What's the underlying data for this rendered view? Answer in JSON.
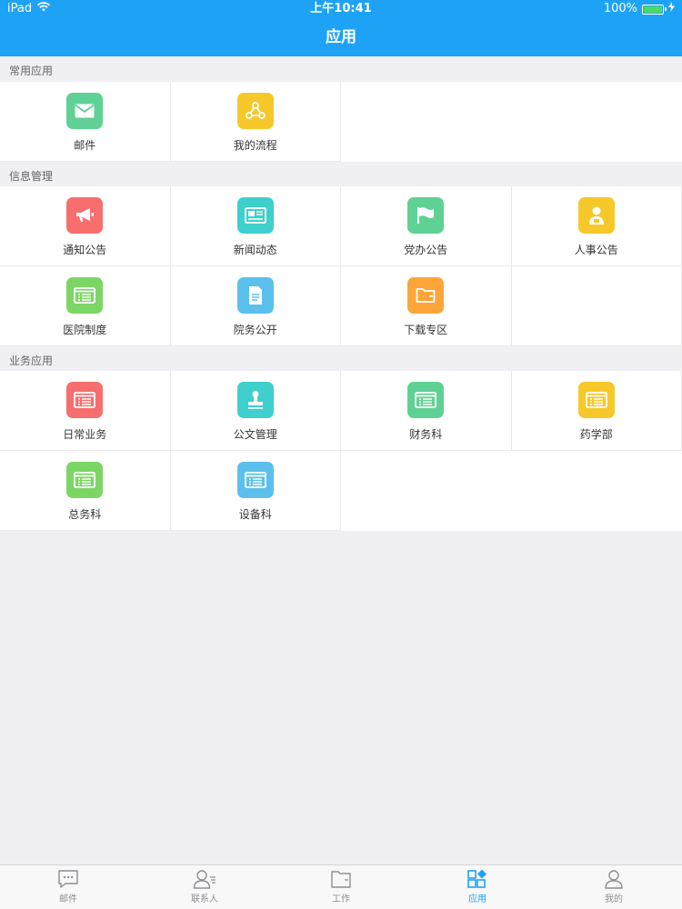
{
  "status_bar": {
    "device": "iPad",
    "time": "上午10:41",
    "battery": "100%"
  },
  "header": {
    "title": "应用"
  },
  "sections": [
    {
      "title": "常用应用",
      "items": [
        {
          "label": "邮件",
          "icon": "mail-icon",
          "color": "#5fd195"
        },
        {
          "label": "我的流程",
          "icon": "workflow-icon",
          "color": "#f7c82a"
        }
      ]
    },
    {
      "title": "信息管理",
      "items": [
        {
          "label": "通知公告",
          "icon": "megaphone-icon",
          "color": "#f76e6e"
        },
        {
          "label": "新闻动态",
          "icon": "newspaper-icon",
          "color": "#3fcfcc"
        },
        {
          "label": "党办公告",
          "icon": "flag-icon",
          "color": "#5fd195"
        },
        {
          "label": "人事公告",
          "icon": "person-icon",
          "color": "#f7c82a"
        },
        {
          "label": "医院制度",
          "icon": "list-icon",
          "color": "#7bd665"
        },
        {
          "label": "院务公开",
          "icon": "document-icon",
          "color": "#5bc0eb"
        },
        {
          "label": "下载专区",
          "icon": "folder-icon",
          "color": "#fca53a"
        }
      ]
    },
    {
      "title": "业务应用",
      "items": [
        {
          "label": "日常业务",
          "icon": "list-icon",
          "color": "#f76e6e"
        },
        {
          "label": "公文管理",
          "icon": "stamp-icon",
          "color": "#3fcfcc"
        },
        {
          "label": "财务科",
          "icon": "list-icon",
          "color": "#5fd195"
        },
        {
          "label": "药学部",
          "icon": "list-icon",
          "color": "#f7c82a"
        },
        {
          "label": "总务科",
          "icon": "list-icon",
          "color": "#7bd665"
        },
        {
          "label": "设备科",
          "icon": "list-icon",
          "color": "#5bc0eb"
        }
      ]
    }
  ],
  "tabbar": {
    "items": [
      {
        "label": "邮件",
        "icon": "message-icon",
        "active": false
      },
      {
        "label": "联系人",
        "icon": "contacts-icon",
        "active": false
      },
      {
        "label": "工作",
        "icon": "folder-icon",
        "active": false
      },
      {
        "label": "应用",
        "icon": "apps-grid-icon",
        "active": true
      },
      {
        "label": "我的",
        "icon": "profile-icon",
        "active": false
      }
    ]
  },
  "colors": {
    "header_bg": "#1ea2f5",
    "active_tab": "#1ea2f5",
    "inactive_tab": "#8e8e93"
  }
}
